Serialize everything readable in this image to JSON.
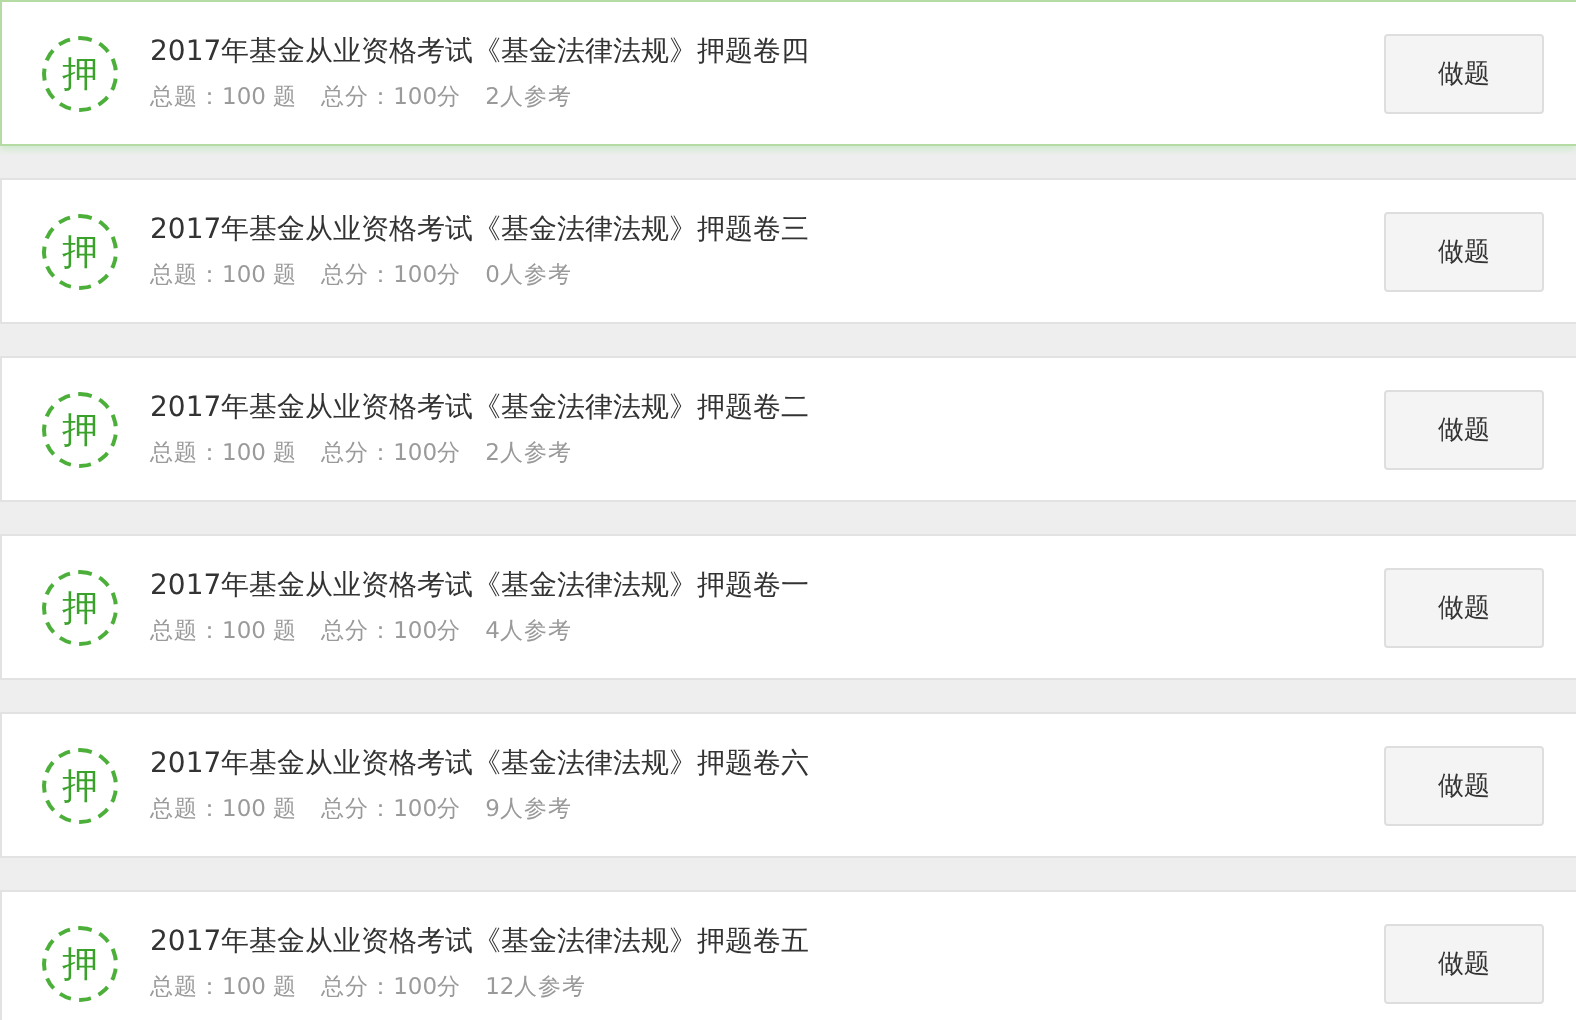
{
  "papers": [
    {
      "badge": "押",
      "title": "2017年基金从业资格考试《基金法律法规》押题卷四",
      "total_questions": "总题：100 题",
      "total_score": "总分：100分",
      "participants": "2人参考",
      "button": "做题",
      "highlighted": true
    },
    {
      "badge": "押",
      "title": "2017年基金从业资格考试《基金法律法规》押题卷三",
      "total_questions": "总题：100 题",
      "total_score": "总分：100分",
      "participants": "0人参考",
      "button": "做题",
      "highlighted": false
    },
    {
      "badge": "押",
      "title": "2017年基金从业资格考试《基金法律法规》押题卷二",
      "total_questions": "总题：100 题",
      "total_score": "总分：100分",
      "participants": "2人参考",
      "button": "做题",
      "highlighted": false
    },
    {
      "badge": "押",
      "title": "2017年基金从业资格考试《基金法律法规》押题卷一",
      "total_questions": "总题：100 题",
      "total_score": "总分：100分",
      "participants": "4人参考",
      "button": "做题",
      "highlighted": false
    },
    {
      "badge": "押",
      "title": "2017年基金从业资格考试《基金法律法规》押题卷六",
      "total_questions": "总题：100 题",
      "total_score": "总分：100分",
      "participants": "9人参考",
      "button": "做题",
      "highlighted": false
    },
    {
      "badge": "押",
      "title": "2017年基金从业资格考试《基金法律法规》押题卷五",
      "total_questions": "总题：100 题",
      "total_score": "总分：100分",
      "participants": "12人参考",
      "button": "做题",
      "highlighted": false
    }
  ]
}
